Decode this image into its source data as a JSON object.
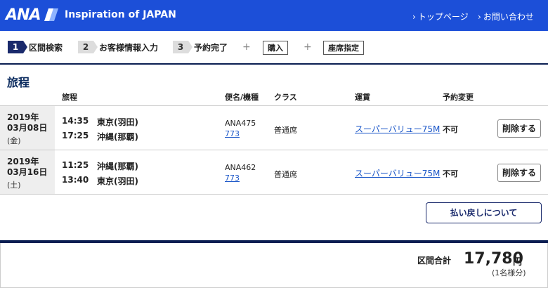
{
  "header": {
    "logo_text": "ANA",
    "tagline": "Inspiration of JAPAN",
    "nav": [
      "トップページ",
      "お問い合わせ"
    ],
    "bg_color": "#1c4fd8"
  },
  "steps": [
    {
      "num": "1",
      "label": "区間検索",
      "active": true
    },
    {
      "num": "2",
      "label": "お客様情報入力",
      "active": false
    },
    {
      "num": "3",
      "label": "予約完了",
      "active": false
    }
  ],
  "plus_symbol": "+",
  "extra_buttons": [
    "購入",
    "座席指定"
  ],
  "section_title": "旅程",
  "columns": [
    "旅程",
    "便名/機種",
    "クラス",
    "運賃",
    "予約変更"
  ],
  "rows": [
    {
      "year": "2019年",
      "date": "03月08日",
      "dow": "(金)",
      "dep_time": "14:35",
      "dep_airport": "東京(羽田)",
      "arr_time": "17:25",
      "arr_airport": "沖縄(那覇)",
      "flight": "ANA475",
      "aircraft": "773",
      "class": "普通席",
      "fare": "スーパーバリュー75M",
      "change": "不可",
      "delete_label": "削除する"
    },
    {
      "year": "2019年",
      "date": "03月16日",
      "dow": "(土)",
      "dep_time": "11:25",
      "dep_airport": "沖縄(那覇)",
      "arr_time": "13:40",
      "arr_airport": "東京(羽田)",
      "flight": "ANA462",
      "aircraft": "773",
      "class": "普通席",
      "fare": "スーパーバリュー75M",
      "change": "不可",
      "delete_label": "削除する"
    }
  ],
  "refund_button": "払い戻しについて",
  "total": {
    "label": "区間合計",
    "amount": "17,780",
    "unit": "円",
    "note": "(1名様分)"
  }
}
